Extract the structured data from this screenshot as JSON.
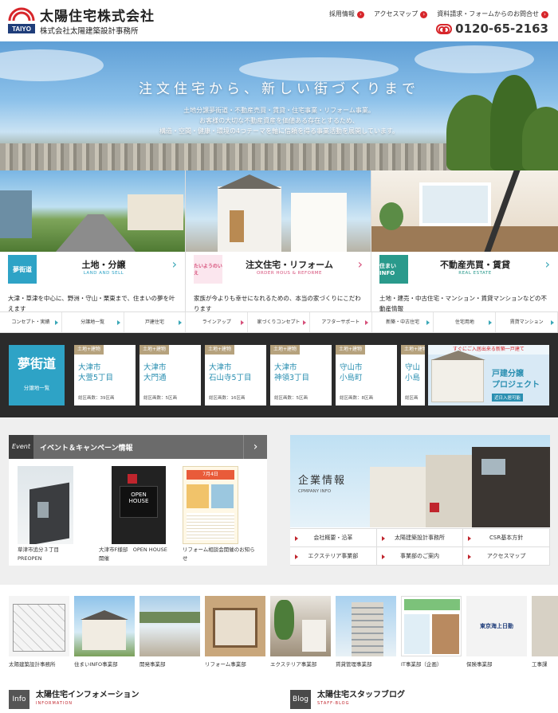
{
  "header": {
    "logo_text": "TAIYO",
    "company_name": "太陽住宅株式会社",
    "company_sub": "株式会社太陽建築設計事務所",
    "nav": [
      "採用情報",
      "アクセスマップ",
      "資料請求・フォームからのお問合せ"
    ],
    "phone": "0120-65-2163",
    "accent": "#d7262b"
  },
  "hero": {
    "title": "注文住宅から、新しい街づくりまで",
    "lines": [
      "土地分譲夢街道・不動産売買・賃貸・住宅事業・リフォーム事業。",
      "お客様の大切な不動産資産を価値ある存在とするため、",
      "構造・空間・健康・環境の4つテーマを軸に信頼を得る事業活動を展開しています。"
    ]
  },
  "cards": [
    {
      "logo": "夢街道",
      "title": "土地・分譲",
      "sub": "LAND AND SELL",
      "desc": "大津・草津を中心に、野洲・守山・栗東まで、住まいの夢を叶えます",
      "color": "#2ea3c6"
    },
    {
      "logo": "たいようのいえ",
      "title": "注文住宅・リフォーム",
      "sub": "ORDER HOUS & REFORME",
      "desc": "家族が今よりも幸せになれるための、本当の家づくりにこだわります",
      "color": "#d6507a"
    },
    {
      "logo": "住まいINFO",
      "title": "不動産売買・賃貸",
      "sub": "REAL ESTATE",
      "desc": "土地・建売・中古住宅・マンション・賃貸マンションなどの不動産情報",
      "color": "#2a9a8c"
    }
  ],
  "card_links": [
    "コンセプト・実績",
    "分譲地一覧",
    "戸建住宅",
    "ラインアップ",
    "家づくりコンセプト",
    "アフターサポート",
    "新築・中古住宅",
    "住宅用地",
    "賃貸マンション"
  ],
  "lots_panel": {
    "yume_logo": "夢街道",
    "yume_button": "分譲地一覧",
    "lots": [
      {
        "tag": "土地+建物",
        "name1": "大津市",
        "name2": "大萱5丁目",
        "count": "総区画数：39区画"
      },
      {
        "tag": "土地+建物",
        "name1": "大津市",
        "name2": "大門通",
        "count": "総区画数：5区画"
      },
      {
        "tag": "土地+建物",
        "name1": "大津市",
        "name2": "石山寺5丁目",
        "count": "総区画数：16区画"
      },
      {
        "tag": "土地+建物",
        "name1": "大津市",
        "name2": "神領3丁目",
        "count": "総区画数：5区画"
      },
      {
        "tag": "土地+建物",
        "name1": "守山市",
        "name2": "小島町",
        "count": "総区画数：8区画"
      },
      {
        "tag": "土地+建物",
        "name1": "守山",
        "name2": "小島",
        "count": "総区画"
      }
    ],
    "project": {
      "top": "すぐにご入居出来る新築一戸建て",
      "title1": "戸建分譲",
      "title2": "プロジェクト",
      "button": "近日入居可能"
    }
  },
  "event": {
    "tag": "Event",
    "title": "イベント＆キャンペーン情報",
    "items": [
      {
        "cap": "草津市追分３丁目 PREOPEN"
      },
      {
        "cap": "大津市F様邸　OPEN HOUSE　開催",
        "sign1": "OPEN",
        "sign2": "HOUSE"
      },
      {
        "cap": "リフォーム相談会開催のお知らせ",
        "flyer_date": "7月4日"
      }
    ]
  },
  "company": {
    "title": "企業情報",
    "sub": "CPMPANY INFO",
    "links": [
      "会社概要・沿革",
      "太陽建築設計事務所",
      "CSR基本方針",
      "エクステリア事業部",
      "事業部のご案内",
      "アクセスマップ"
    ]
  },
  "departments": [
    "太陽建築設計事務所",
    "住まいINFO事業部",
    "開発事業部",
    "リフォーム事業部",
    "エクステリア事業部",
    "賃貸管理事業部",
    "IT事業部（企画）",
    "保険事業部",
    "工事課"
  ],
  "insurance_logo": "東京海上日動",
  "info_sections": [
    {
      "tag": "Info",
      "title": "太陽住宅インフォメーション",
      "sub": "INFORMATION"
    },
    {
      "tag": "Blog",
      "title": "太陽住宅スタッフブログ",
      "sub": "STAFF-BLOG"
    }
  ]
}
